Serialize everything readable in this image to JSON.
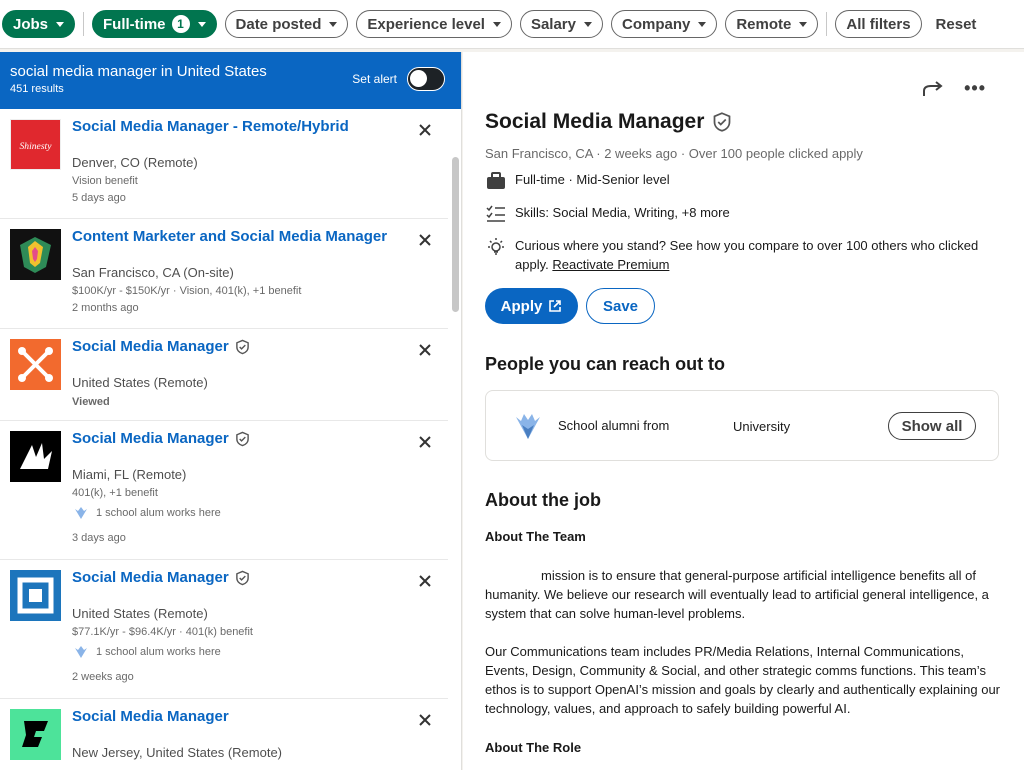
{
  "filters": {
    "jobs": "Jobs",
    "fulltime": "Full-time",
    "fulltime_count": "1",
    "date_posted": "Date posted",
    "experience": "Experience level",
    "salary": "Salary",
    "company": "Company",
    "remote": "Remote",
    "all_filters": "All filters",
    "reset": "Reset"
  },
  "search": {
    "query": "social media manager in United States",
    "results": "451 results",
    "set_alert": "Set alert"
  },
  "jobs": [
    {
      "title": "Social Media Manager - Remote/Hybrid",
      "location": "Denver, CO (Remote)",
      "meta1": "Vision benefit",
      "meta2": "5 days ago"
    },
    {
      "title": "Content Marketer and Social Media Manager",
      "location": "San Francisco, CA (On-site)",
      "meta1": "$100K/yr - $150K/yr · Vision, 401(k), +1 benefit",
      "meta2": "2 months ago"
    },
    {
      "title": "Social Media Manager",
      "location": "United States (Remote)",
      "viewed": "Viewed"
    },
    {
      "title": "Social Media Manager",
      "location": "Miami, FL (Remote)",
      "meta1": "401(k), +1 benefit",
      "alum": "1 school alum works here",
      "meta2": "3 days ago"
    },
    {
      "title": "Social Media Manager",
      "location": "United States (Remote)",
      "meta1": "$77.1K/yr - $96.4K/yr · 401(k) benefit",
      "alum": "1 school alum works here",
      "meta2": "2 weeks ago"
    },
    {
      "title": "Social Media Manager",
      "location": "New Jersey, United States (Remote)"
    }
  ],
  "detail": {
    "title": "Social Media Manager",
    "subtitle": "San Francisco, CA · 2 weeks ago · Over 100 people clicked apply",
    "insight1": "Full-time · Mid-Senior level",
    "insight2": "Skills: Social Media, Writing, +8 more",
    "insight3a": "Curious where you stand? See how you compare to over 100 others who clicked",
    "insight3b": "apply.",
    "insight3link": "Reactivate Premium",
    "apply": "Apply",
    "save": "Save",
    "people_heading": "People you can reach out to",
    "alumni_text": "School alumni from",
    "university": "University",
    "show_all": "Show all",
    "about_heading": "About the job",
    "team_heading": "About The Team",
    "para1": "mission is to ensure that general-purpose artificial intelligence benefits all of humanity. We believe our research will eventually lead to artificial general intelligence, a system that can solve human-level problems.",
    "para2": "Our Communications team includes PR/Media Relations, Internal Communications, Events, Design, Community & Social, and other strategic comms functions. This team’s ethos is to support OpenAI’s mission and goals by clearly and authentically explaining our technology, values, and approach to safely building powerful AI.",
    "role_heading": "About The Role"
  },
  "logos": {
    "logo1_text": "Shinesty"
  },
  "colors": {
    "brand_blue": "#0a66c2",
    "green": "#01754f"
  }
}
